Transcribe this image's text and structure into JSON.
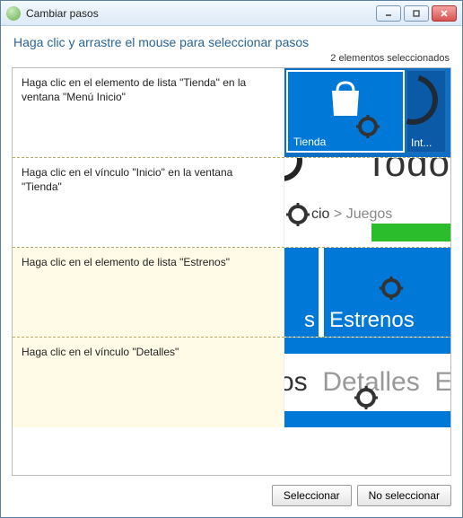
{
  "window": {
    "title": "Cambiar pasos"
  },
  "instruction": "Haga clic y arrastre el mouse para seleccionar pasos",
  "selection_count_label": "2 elementos seleccionados",
  "steps": [
    {
      "description": "Haga clic en el elemento de lista \"Tienda\" en la ventana \"Menú Inicio\"",
      "selected": false,
      "thumb": {
        "tile_label": "Tienda",
        "tile2_label": "Int..."
      }
    },
    {
      "description": "Haga clic en el vínculo \"Inicio\" en la ventana \"Tienda\"",
      "selected": false,
      "thumb": {
        "big_text": "Todo",
        "crumb_active": "cio",
        "crumb_sep": " > ",
        "crumb_next": "Juegos"
      }
    },
    {
      "description": "Haga clic en el elemento de lista \"Estrenos\"",
      "selected": true,
      "thumb": {
        "left_fragment": "s",
        "right_label": "Estrenos"
      }
    },
    {
      "description": "Haga clic en el vínculo \"Detalles\"",
      "selected": true,
      "thumb": {
        "left_fragment": "os",
        "mid_label": "Detalles",
        "right_fragment": "Es"
      }
    }
  ],
  "buttons": {
    "select": "Seleccionar",
    "deselect": "No seleccionar"
  },
  "icons": {
    "target": "target-icon",
    "bag": "shopping-bag-icon"
  }
}
